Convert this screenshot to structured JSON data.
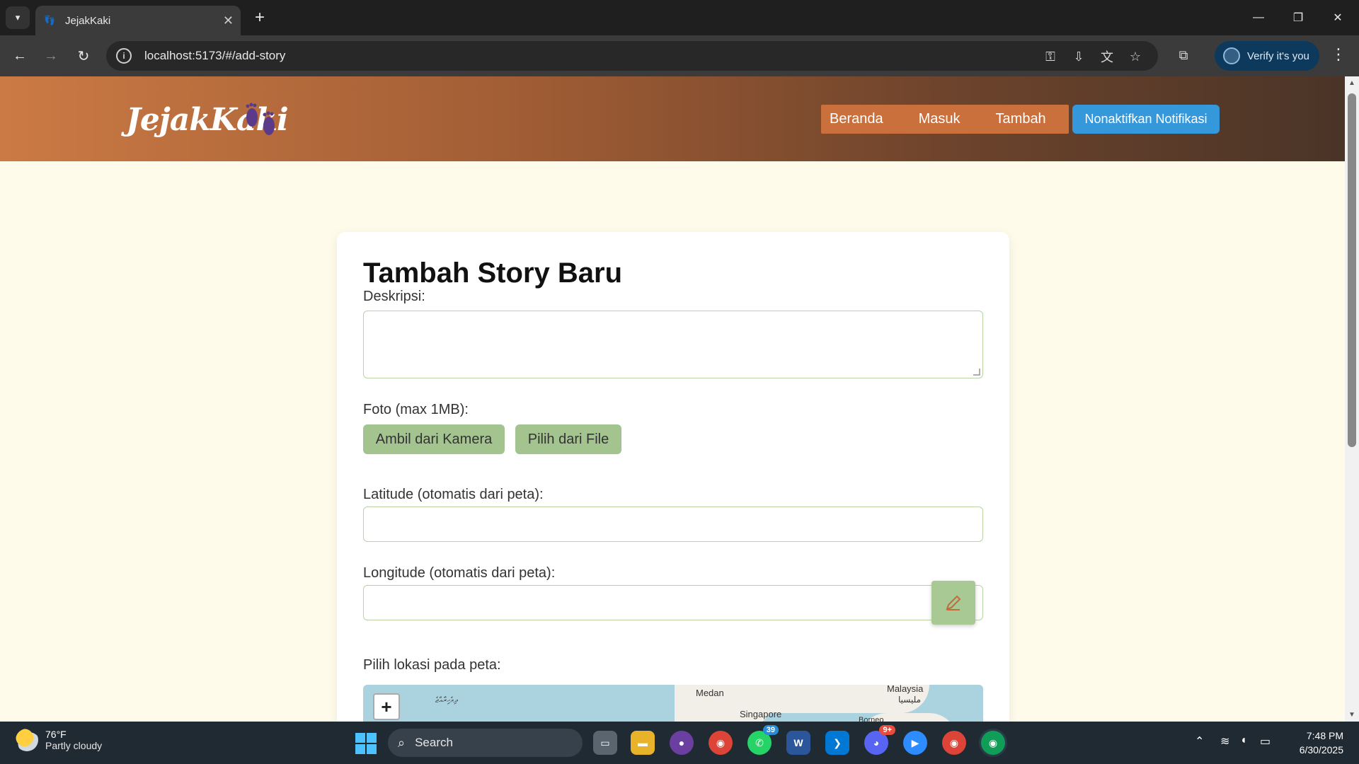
{
  "browser": {
    "tab_title": "JejakKaki",
    "url": "localhost:5173/#/add-story",
    "verify_label": "Verify it's you"
  },
  "site": {
    "logo": "JejakKaki",
    "nav": [
      "Beranda",
      "Masuk",
      "Tambah"
    ],
    "notif_button": "Nonaktifkan Notifikasi"
  },
  "form": {
    "title": "Tambah Story Baru",
    "description_label": "Deskripsi:",
    "photo_label": "Foto (max 1MB):",
    "camera_button": "Ambil dari Kamera",
    "file_button": "Pilih dari File",
    "latitude_label": "Latitude (otomatis dari peta):",
    "longitude_label": "Longitude (otomatis dari peta):",
    "map_label": "Pilih lokasi pada peta:"
  },
  "map": {
    "labels": {
      "medan": "Medan",
      "singapore": "Singapore",
      "malaysia": "Malaysia",
      "malaysia_local": "مليسيا",
      "borneo": "Borneo",
      "maldives": "ދިވެހިރާއްޖެ"
    },
    "zoom_in": "+"
  },
  "taskbar": {
    "temp": "76°F",
    "weather": "Partly cloudy",
    "search": "Search",
    "whatsapp_badge": "39",
    "discord_badge": "9+",
    "time": "7:48 PM",
    "date": "6/30/2025"
  },
  "colors": {
    "accent_green": "#a3c48f",
    "notif_blue": "#3498db",
    "nav_orange": "#c9703c"
  }
}
